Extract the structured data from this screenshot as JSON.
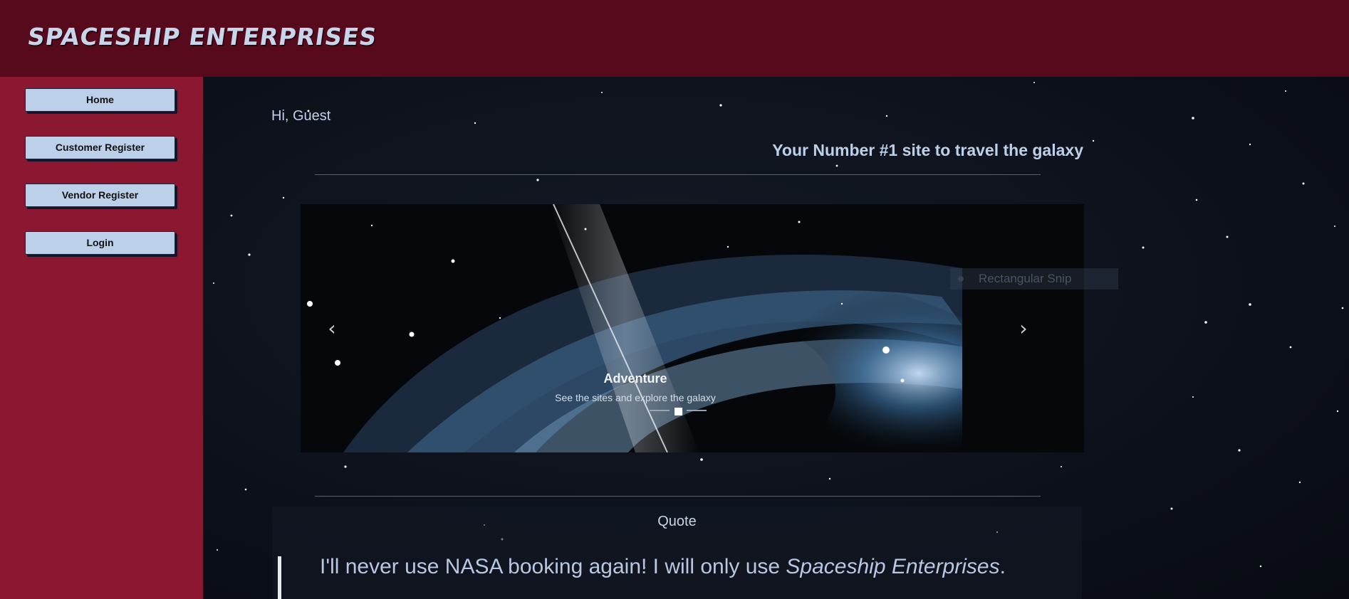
{
  "header": {
    "brand": "Spaceship Enterprises"
  },
  "sidebar": {
    "items": [
      {
        "label": "Home"
      },
      {
        "label": "Customer Register"
      },
      {
        "label": "Vendor Register"
      },
      {
        "label": "Login"
      }
    ]
  },
  "main": {
    "greeting": "Hi, Guest",
    "tagline": "Your Number #1 site to travel the galaxy",
    "carousel": {
      "slide_title": "Adventure",
      "slide_caption": "See the sites and explore the galaxy",
      "prev_icon": "‹",
      "next_icon": "›",
      "active_slide": 1,
      "slide_count": 3
    },
    "overlay": {
      "label": "Rectangular Snip"
    },
    "quote": {
      "heading": "Quote",
      "text_before": "I'll never use NASA booking again! I will only use ",
      "text_emphasis": "Spaceship Enterprises",
      "text_after": "."
    }
  }
}
